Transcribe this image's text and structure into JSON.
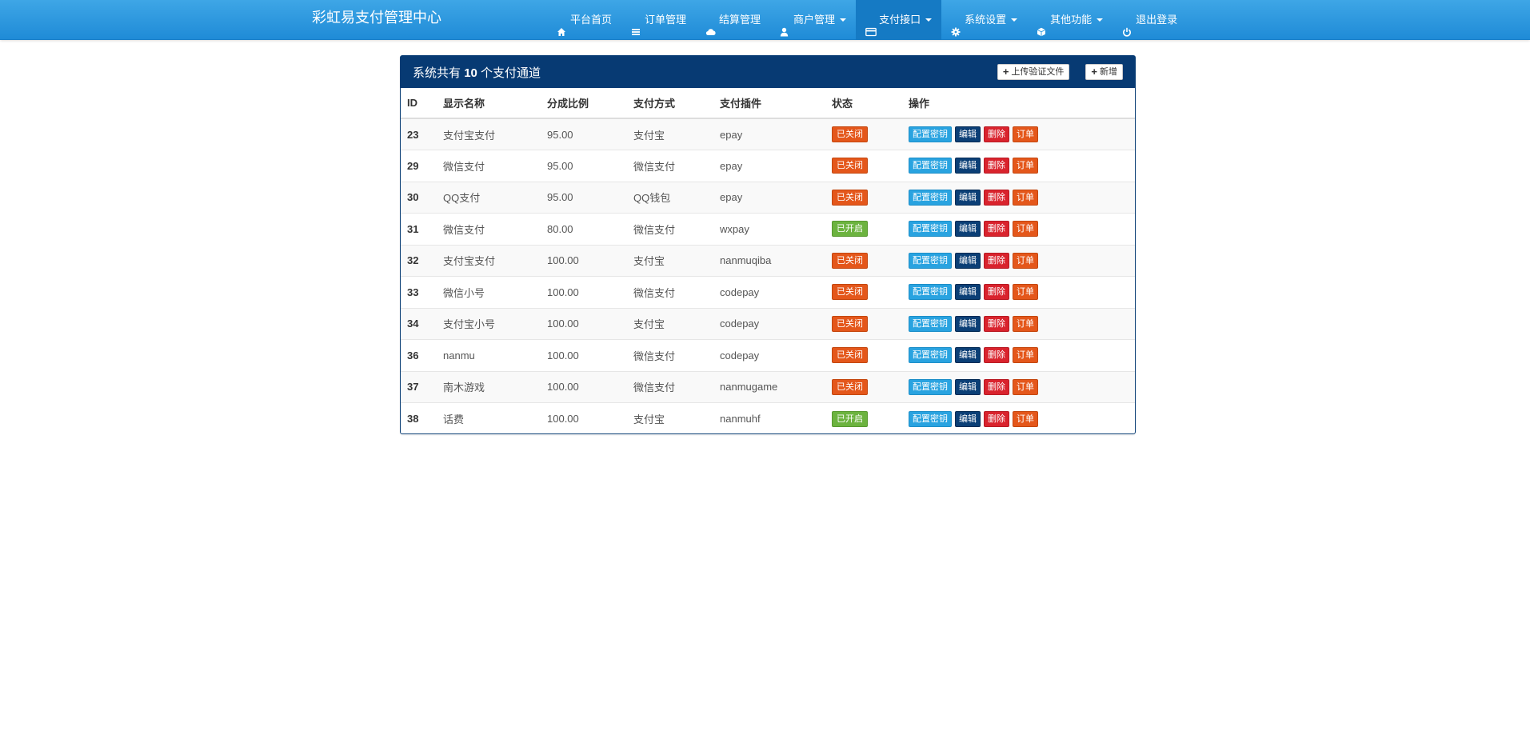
{
  "header": {
    "brand": "彩虹易支付管理中心",
    "nav": [
      {
        "label": "平台首页",
        "icon": "home-icon",
        "dropdown": false,
        "active": false
      },
      {
        "label": "订单管理",
        "icon": "list-icon",
        "dropdown": false,
        "active": false
      },
      {
        "label": "结算管理",
        "icon": "cloud-icon",
        "dropdown": false,
        "active": false
      },
      {
        "label": "商户管理",
        "icon": "user-icon",
        "dropdown": true,
        "active": false
      },
      {
        "label": "支付接口",
        "icon": "credit-card-icon",
        "dropdown": true,
        "active": true
      },
      {
        "label": "系统设置",
        "icon": "gear-icon",
        "dropdown": true,
        "active": false
      },
      {
        "label": "其他功能",
        "icon": "cube-icon",
        "dropdown": true,
        "active": false
      },
      {
        "label": "退出登录",
        "icon": "power-icon",
        "dropdown": false,
        "active": false
      }
    ]
  },
  "panel": {
    "title_prefix": "系统共有",
    "count": "10",
    "title_suffix": "个支付通道",
    "upload_label": "上传验证文件",
    "add_label": "新增"
  },
  "table": {
    "columns": [
      "ID",
      "显示名称",
      "分成比例",
      "支付方式",
      "支付插件",
      "状态",
      "操作"
    ],
    "actions": {
      "config": "配置密钥",
      "edit": "编辑",
      "delete": "删除",
      "orders": "订单"
    },
    "status_labels": {
      "on": "已开启",
      "off": "已关闭"
    },
    "rows": [
      {
        "id": "23",
        "name": "支付宝支付",
        "rate": "95.00",
        "method": "支付宝",
        "plugin": "epay",
        "status": "已关闭",
        "on": false
      },
      {
        "id": "29",
        "name": "微信支付",
        "rate": "95.00",
        "method": "微信支付",
        "plugin": "epay",
        "status": "已关闭",
        "on": false
      },
      {
        "id": "30",
        "name": "QQ支付",
        "rate": "95.00",
        "method": "QQ钱包",
        "plugin": "epay",
        "status": "已关闭",
        "on": false
      },
      {
        "id": "31",
        "name": "微信支付",
        "rate": "80.00",
        "method": "微信支付",
        "plugin": "wxpay",
        "status": "已开启",
        "on": true
      },
      {
        "id": "32",
        "name": "支付宝支付",
        "rate": "100.00",
        "method": "支付宝",
        "plugin": "nanmuqiba",
        "status": "已关闭",
        "on": false
      },
      {
        "id": "33",
        "name": "微信小号",
        "rate": "100.00",
        "method": "微信支付",
        "plugin": "codepay",
        "status": "已关闭",
        "on": false
      },
      {
        "id": "34",
        "name": "支付宝小号",
        "rate": "100.00",
        "method": "支付宝",
        "plugin": "codepay",
        "status": "已关闭",
        "on": false
      },
      {
        "id": "36",
        "name": "nanmu",
        "rate": "100.00",
        "method": "微信支付",
        "plugin": "codepay",
        "status": "已关闭",
        "on": false
      },
      {
        "id": "37",
        "name": "南木游戏",
        "rate": "100.00",
        "method": "微信支付",
        "plugin": "nanmugame",
        "status": "已关闭",
        "on": false
      },
      {
        "id": "38",
        "name": "话费",
        "rate": "100.00",
        "method": "支付宝",
        "plugin": "nanmuhf",
        "status": "已开启",
        "on": true
      }
    ]
  },
  "colors": {
    "navbar": "#2a98dd",
    "panel_heading": "#073a73",
    "status_off": "#e4571b",
    "status_on": "#6cb33f",
    "config_btn": "#29a3e0",
    "edit_btn": "#0b3f76",
    "delete_btn": "#d9232d",
    "orders_btn": "#e4571b"
  }
}
